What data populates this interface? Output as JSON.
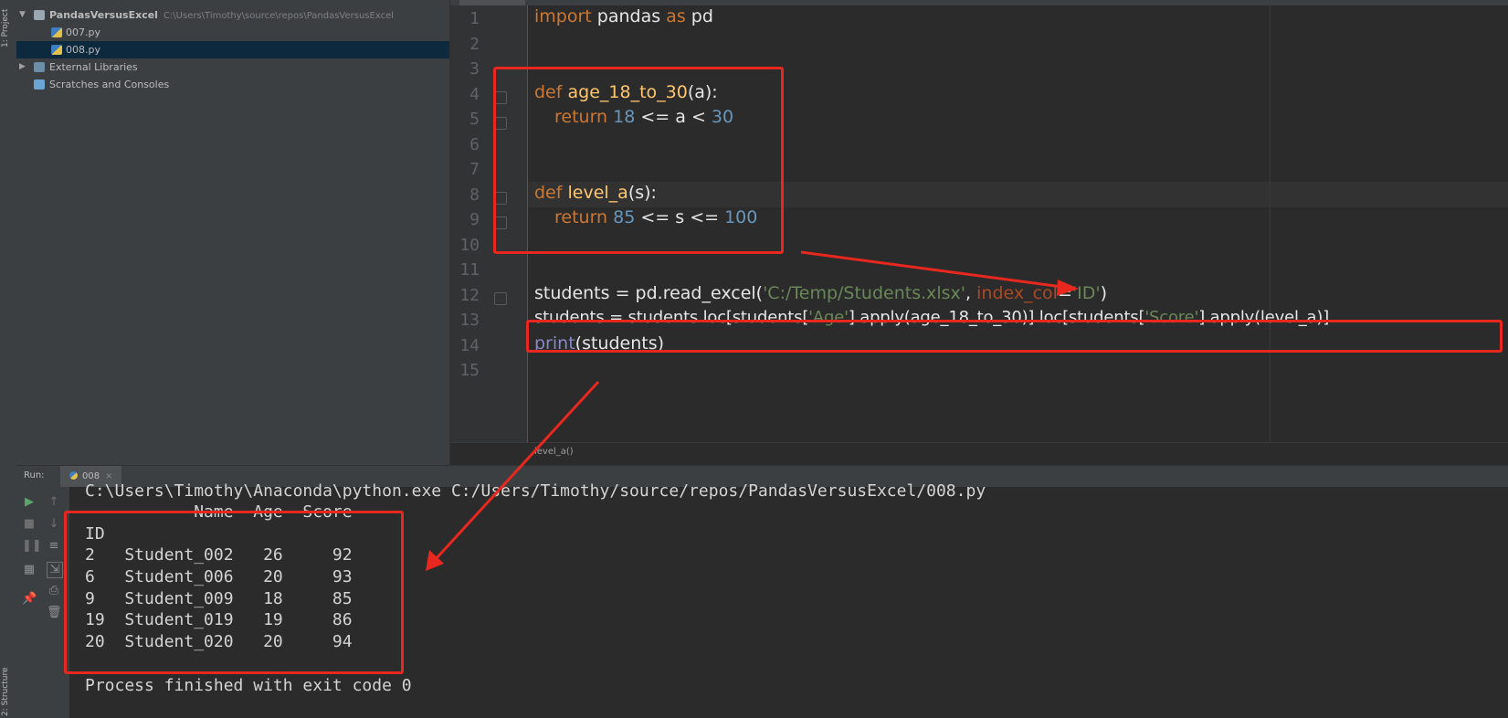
{
  "sidebar": {
    "vertical_tabs": {
      "project": "1: Project",
      "structure": "2: Structure"
    },
    "tree": [
      {
        "label": "PandasVersusExcel",
        "path": "C:\\Users\\Timothy\\source\\repos\\PandasVersusExcel",
        "expanded": true,
        "icon": "folder-icon"
      },
      {
        "label": "007.py",
        "icon": "python-file-icon"
      },
      {
        "label": "008.py",
        "icon": "python-file-icon",
        "selected": true
      },
      {
        "label": "External Libraries",
        "icon": "library-icon",
        "expanded": false
      },
      {
        "label": "Scratches and Consoles",
        "icon": "scratches-icon"
      }
    ]
  },
  "editor": {
    "line_numbers": [
      "1",
      "2",
      "3",
      "4",
      "5",
      "6",
      "7",
      "8",
      "9",
      "10",
      "11",
      "12",
      "13",
      "14",
      "15"
    ],
    "breadcrumb": "level_a()",
    "code": {
      "l1": {
        "kw1": "import",
        "mod": " pandas ",
        "kw2": "as",
        "alias": " pd"
      },
      "l4": {
        "kw": "def",
        "fn": " age_18_to_30",
        "rest": "(a):"
      },
      "l5": {
        "kw": "return",
        "sp": " ",
        "n1": "18",
        "mid": " <= a < ",
        "n2": "30"
      },
      "l8": {
        "kw": "def",
        "fn": " level_a",
        "rest": "(s):"
      },
      "l9": {
        "kw": "return",
        "sp": " ",
        "n1": "85",
        "mid": " <= s <= ",
        "n2": "100"
      },
      "l12": {
        "a": "students = pd.read_excel(",
        "s1": "'C:/Temp/Students.xlsx'",
        "b": ", ",
        "p": "index_col",
        "c": "=",
        "s2": "'ID'",
        "d": ")"
      },
      "l13": {
        "a": "students = students.loc[students[",
        "s1": "'Age'",
        "b": "].apply(age_18_to_30)].loc[students[",
        "s2": "'Score'",
        "c": "].apply(level_a)]"
      },
      "l14": {
        "fn": "print",
        "rest": "(students)"
      }
    }
  },
  "run": {
    "label": "Run:",
    "tab": "008",
    "console": {
      "command": "C:\\Users\\Timothy\\Anaconda\\python.exe C:/Users/Timothy/source/repos/PandasVersusExcel/008.py",
      "header": "           Name  Age  Score",
      "index_label": "ID",
      "rows": [
        "2   Student_002   26     92",
        "6   Student_006   20     93",
        "9   Student_009   18     85",
        "19  Student_019   19     86",
        "20  Student_020   20     94"
      ],
      "exit": "Process finished with exit code 0"
    }
  },
  "colors": {
    "annotation": "#e8281e",
    "keyword": "#cc7832",
    "function": "#ffc66d",
    "number": "#6897bb",
    "string": "#6a8759"
  }
}
